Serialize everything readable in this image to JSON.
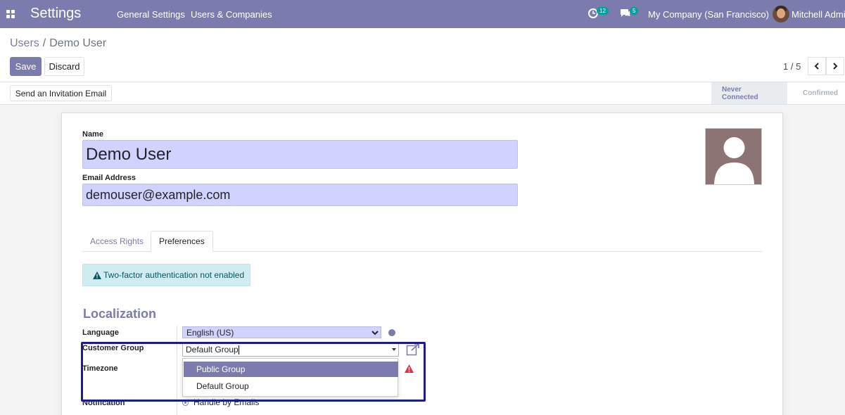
{
  "navbar": {
    "app_title": "Settings",
    "menu": [
      "General Settings",
      "Users & Companies"
    ],
    "activity_count": "12",
    "messages_count": "5",
    "company": "My Company (San Francisco)",
    "user": "Mitchell Admin"
  },
  "breadcrumb": {
    "parent": "Users",
    "separator": "/",
    "current": "Demo User"
  },
  "buttons": {
    "save": "Save",
    "discard": "Discard",
    "invite": "Send an Invitation Email"
  },
  "pager": {
    "value": "1 / 5"
  },
  "statusbar": {
    "steps": [
      "Never Connected",
      "Confirmed"
    ],
    "active": "Never Connected"
  },
  "form": {
    "name_label": "Name",
    "name_value": "Demo User",
    "email_label": "Email Address",
    "email_value": "demouser@example.com"
  },
  "tabs": [
    "Access Rights",
    "Preferences"
  ],
  "active_tab": "Preferences",
  "alert": {
    "text": "Two-factor authentication not enabled"
  },
  "localization": {
    "title": "Localization",
    "language_label": "Language",
    "language_value": "English (US)",
    "customer_group_label": "Customer Group",
    "customer_group_value": "Default Group",
    "timezone_label": "Timezone",
    "notification_label": "Notification",
    "notification_value": "Handle by Emails"
  },
  "dropdown": {
    "options": [
      "Public Group",
      "Default Group"
    ],
    "highlighted": "Public Group"
  },
  "colors": {
    "brand": "#7c7bad",
    "input_bg": "#d2d2ff",
    "highlight_border": "#1c1c8c",
    "alert_bg": "#d1ecf1"
  },
  "icons": [
    "apps-grid-icon",
    "activity-clock-icon",
    "chat-bubble-icon",
    "chevron-left-icon",
    "chevron-right-icon",
    "warning-triangle-icon",
    "globe-icon",
    "external-link-icon",
    "avatar-placeholder-icon"
  ]
}
